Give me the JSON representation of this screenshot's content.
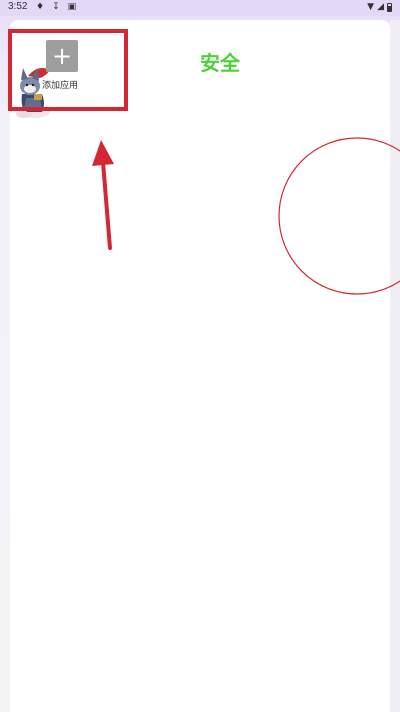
{
  "status_bar": {
    "time": "3:52",
    "left_icons": [
      "cat-icon",
      "download-icon",
      "app-icon"
    ],
    "right_icons": [
      "wifi-icon",
      "signal-icon",
      "battery-icon"
    ]
  },
  "add_app": {
    "plus_symbol": "+",
    "label": "添加应用"
  },
  "page": {
    "title": "安全"
  },
  "colors": {
    "title": "#4cd137",
    "annotation": "#d42732",
    "add_button": "#9e9e9e"
  }
}
